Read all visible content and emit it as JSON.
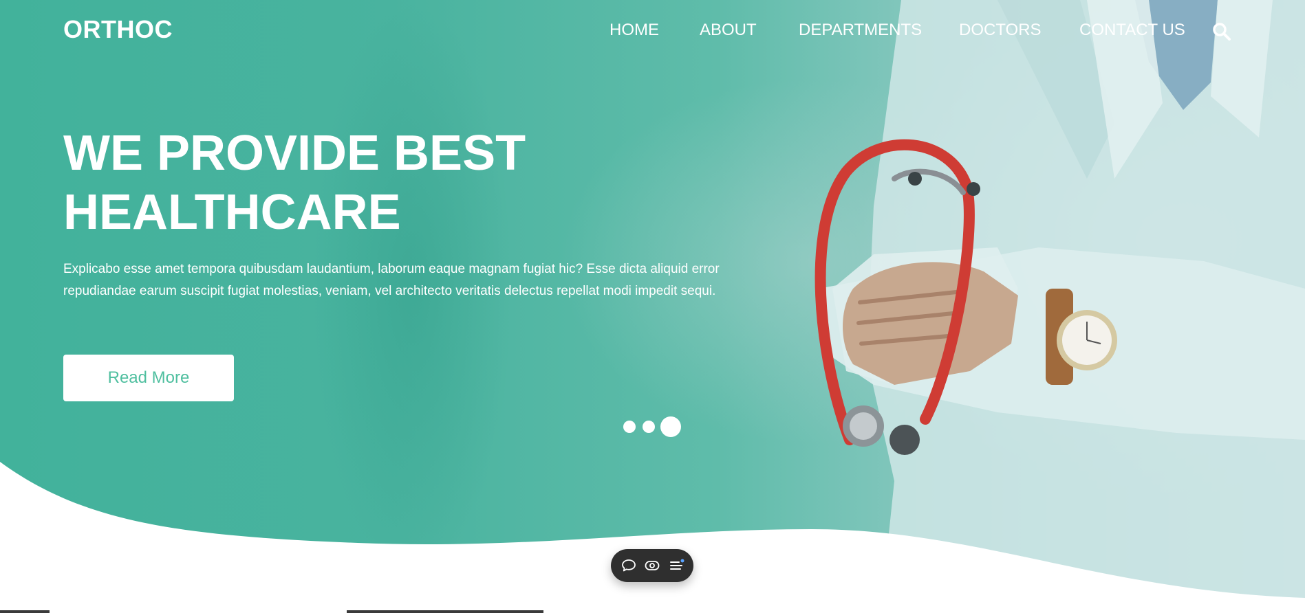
{
  "brand": {
    "logo": "ORTHOC"
  },
  "nav": {
    "items": [
      {
        "label": "HOME"
      },
      {
        "label": "ABOUT"
      },
      {
        "label": "DEPARTMENTS"
      },
      {
        "label": "DOCTORS"
      },
      {
        "label": "CONTACT US"
      }
    ],
    "search_icon": "search-icon"
  },
  "hero": {
    "headline_line1": "WE PROVIDE BEST",
    "headline_line2": "HEALTHCARE",
    "description": "Explicabo esse amet tempora quibusdam laudantium, laborum eaque magnam fugiat hic? Esse dicta aliquid error repudiandae earum suscipit fugiat molestias, veniam, vel architecto veritatis delectus repellat modi impedit sequi.",
    "cta_label": "Read More"
  },
  "slider": {
    "slide_count": 3,
    "active_index": 2
  },
  "toolbar": {
    "icons": [
      "chat-icon",
      "eye-icon",
      "menu-list-icon"
    ]
  },
  "colors": {
    "accent": "#4fbf9f",
    "hero_teal": "#49b39f",
    "white": "#ffffff",
    "toolbar_bg": "#2f2f2f"
  }
}
